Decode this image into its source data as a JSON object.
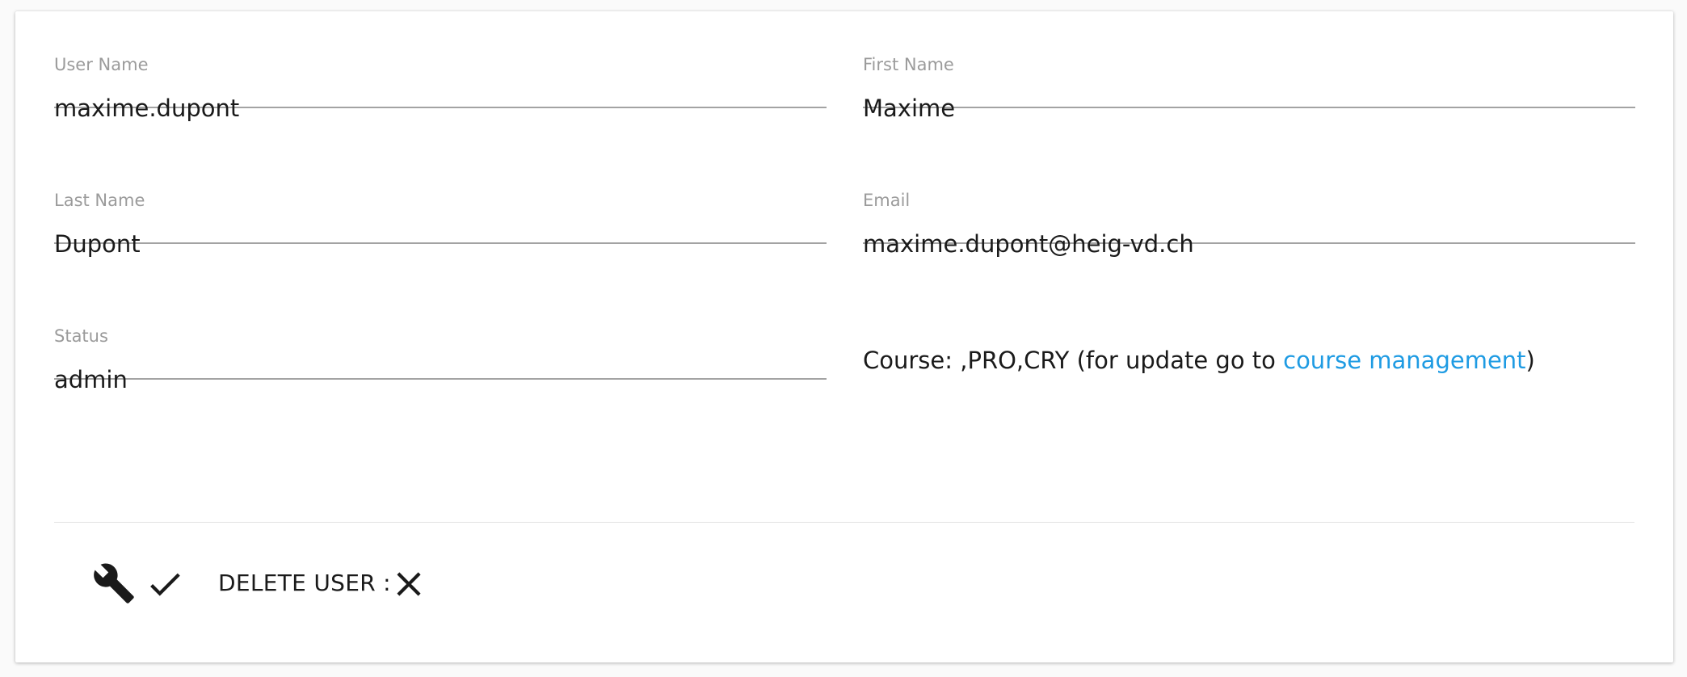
{
  "form": {
    "user_name": {
      "label": "User Name",
      "value": "maxime.dupont"
    },
    "first_name": {
      "label": "First Name",
      "value": "Maxime"
    },
    "last_name": {
      "label": "Last Name",
      "value": "Dupont"
    },
    "email": {
      "label": "Email",
      "value": "maxime.dupont@heig-vd.ch"
    },
    "status": {
      "label": "Status",
      "value": "admin"
    }
  },
  "course": {
    "prefix": "Course: ,PRO,CRY (for update go to ",
    "link_text": "course management",
    "suffix": ")",
    "link_color": "#1e9be3"
  },
  "actions": {
    "edit_icon": "wrench-icon",
    "save_icon": "check-icon",
    "delete_label": "DELETE USER :",
    "delete_icon": "close-icon"
  }
}
